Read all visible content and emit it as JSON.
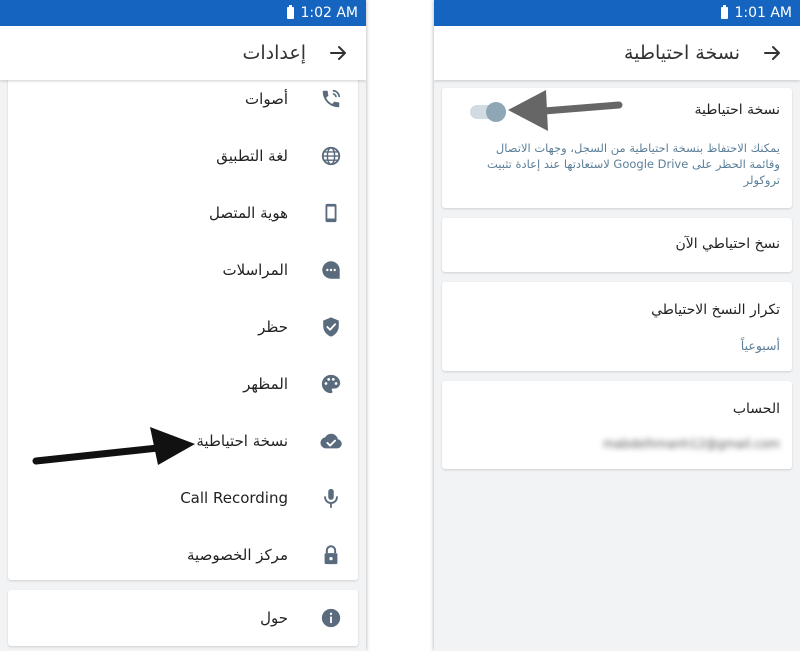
{
  "left_screen": {
    "status_time": "1:02 AM",
    "title": "إعدادات",
    "menu_items": [
      {
        "label": "أصوات",
        "icon": "phone-ring-icon"
      },
      {
        "label": "لغة التطبيق",
        "icon": "globe-icon"
      },
      {
        "label": "هوية المتصل",
        "icon": "smartphone-icon"
      },
      {
        "label": "المراسلات",
        "icon": "chat-bubble-icon"
      },
      {
        "label": "حظر",
        "icon": "shield-check-icon"
      },
      {
        "label": "المظهر",
        "icon": "palette-icon"
      },
      {
        "label": "نسخة احتياطية",
        "icon": "cloud-done-icon"
      },
      {
        "label": "Call Recording",
        "icon": "microphone-icon"
      },
      {
        "label": "مركز الخصوصية",
        "icon": "lock-icon"
      }
    ],
    "about_item": {
      "label": "حول",
      "icon": "info-icon"
    }
  },
  "right_screen": {
    "status_time": "1:01 AM",
    "title": "نسخة احتياطية",
    "backup_card": {
      "title": "نسخة احتياطية",
      "description_line1": "يمكنك الاحتفاظ بنسخة احتياطية من السجل، وجهات الاتصال",
      "description_line2": "وقائمة الحظر على Google Drive لاستعادتها عند إعادة تثبيت",
      "description_line3": "تروكولر",
      "toggle_on": false
    },
    "backup_now_label": "نسخ احتياطي الآن",
    "frequency": {
      "title": "تكرار النسخ الاحتياطي",
      "value": "أسبوعياً"
    },
    "account": {
      "title": "الحساب",
      "value": "mabdelhmanh12@gmail.com"
    }
  },
  "colors": {
    "status_bar": "#1565c0",
    "icon": "#5a6b7d",
    "link_text": "#5b7f98",
    "background": "#f2f3f5"
  }
}
